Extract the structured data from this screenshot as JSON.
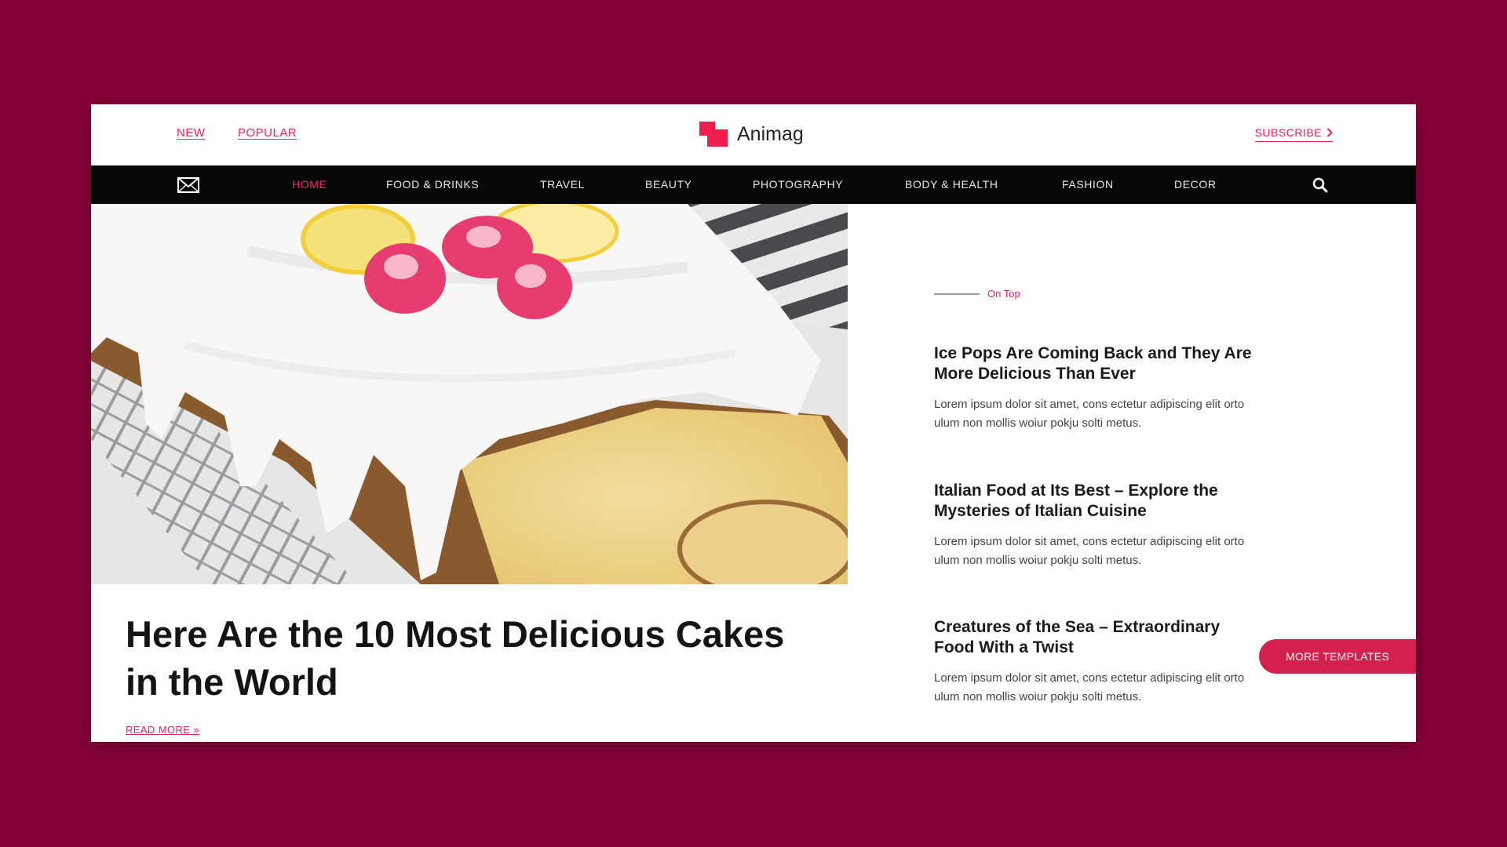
{
  "header": {
    "links": [
      "NEW",
      "POPULAR"
    ],
    "logo_text": "Animag",
    "subscribe_label": "SUBSCRIBE",
    "accent_color": "#e8225a"
  },
  "nav": {
    "items": [
      "HOME",
      "FOOD & DRINKS",
      "TRAVEL",
      "BEAUTY",
      "PHOTOGRAPHY",
      "BODY & HEALTH",
      "FASHION",
      "DECOR"
    ],
    "active": "HOME",
    "icons": [
      "mail-icon",
      "search-icon"
    ]
  },
  "hero": {
    "headline": "Here Are the 10 Most Delicious Cakes in the World",
    "read_more": "READ MORE »"
  },
  "sidebar": {
    "section_label": "On Top",
    "articles": [
      {
        "title": "Ice Pops Are Coming Back and They Are More Delicious Than Ever",
        "excerpt": "Lorem ipsum dolor sit amet, cons ectetur adipiscing elit orto ulum non mollis woiur pokju solti metus."
      },
      {
        "title": "Italian Food at Its Best – Explore the Mysteries of Italian Cuisine",
        "excerpt": "Lorem ipsum dolor sit amet, cons ectetur adipiscing elit orto ulum non mollis woiur pokju solti metus."
      },
      {
        "title": "Creatures of the Sea – Extraordinary Food With a Twist",
        "excerpt": "Lorem ipsum dolor sit amet, cons ectetur adipiscing elit orto ulum non mollis woiur pokju solti metus."
      }
    ]
  },
  "more_templates_label": "MORE TEMPLATES",
  "colors": {
    "page_background": "#860337",
    "navbar": "#070707",
    "accent": "#e8225a",
    "button": "#d3214f"
  }
}
